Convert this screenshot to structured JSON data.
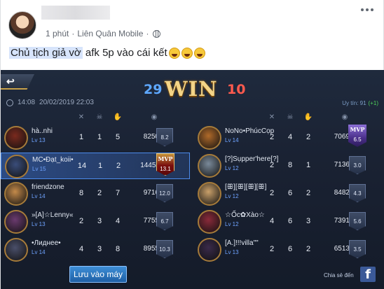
{
  "post": {
    "time": "1 phút",
    "separator": "·",
    "page_name": "Liên Quân Mobile",
    "caption_highlight": "Chủ tịch giả vờ",
    "caption_rest": "afk 5p vào cái kết",
    "emoji": "laughing-tears-emoji"
  },
  "game": {
    "back_label": "↩",
    "score_left": "29",
    "result": "WIN",
    "score_right": "10",
    "duration": "14:08",
    "datetime": "20/02/2019 22:03",
    "uy_tin_label": "Uy tín: 91",
    "uy_tin_delta": "(+1)",
    "save_button": "Lưu vào máy",
    "share_label": "Chia sẻ đến",
    "facebook_glyph": "f",
    "left_team": [
      {
        "name": "hà..nhi",
        "level": "Lv 13",
        "k": "1",
        "d": "1",
        "a": "5",
        "gold": "8250",
        "rating": "8.2",
        "mvp": false
      },
      {
        "name": "MC•Đạt_koii•",
        "level": "Lv 15",
        "k": "14",
        "d": "1",
        "a": "2",
        "gold": "14453",
        "rating": "13.1",
        "mvp": true
      },
      {
        "name": "friendzone",
        "level": "Lv 14",
        "k": "8",
        "d": "2",
        "a": "7",
        "gold": "9716",
        "rating": "12.0",
        "mvp": false
      },
      {
        "name": "»[A]☆Lenny«",
        "level": "Lv 13",
        "k": "2",
        "d": "3",
        "a": "4",
        "gold": "7755",
        "rating": "6.7",
        "mvp": false
      },
      {
        "name": "•Лиднее•",
        "level": "Lv 14",
        "k": "4",
        "d": "3",
        "a": "8",
        "gold": "8955",
        "rating": "10.3",
        "mvp": false
      }
    ],
    "right_team": [
      {
        "name": "NoNo•PhúcCọp",
        "level": "Lv 14",
        "k": "2",
        "d": "4",
        "a": "2",
        "gold": "7069",
        "rating": "6.5",
        "mvp": true
      },
      {
        "name": "[?]Sụpper'here[?]",
        "level": "Lv 12",
        "k": "2",
        "d": "8",
        "a": "1",
        "gold": "7136",
        "rating": "3.0",
        "mvp": false
      },
      {
        "name": "[ꕥ][ꕥ][ꕥ][ꕥ]",
        "level": "Lv 12",
        "k": "2",
        "d": "6",
        "a": "2",
        "gold": "8482",
        "rating": "4.3",
        "mvp": false
      },
      {
        "name": "☆Ốc✿Xào☆",
        "level": "Lv 12",
        "k": "4",
        "d": "6",
        "a": "3",
        "gold": "7391",
        "rating": "5.6",
        "mvp": false
      },
      {
        "name": "[A.]!!!villa\"\"",
        "level": "Lv 13",
        "k": "2",
        "d": "6",
        "a": "2",
        "gold": "6513",
        "rating": "3.5",
        "mvp": false
      }
    ],
    "mvp_label": "MVP",
    "colors": {
      "blue_score": "#5ea8ff",
      "red_score": "#ff5a4e",
      "win_gold": "#f3d487",
      "mvp_row": "#4c8bec"
    }
  }
}
